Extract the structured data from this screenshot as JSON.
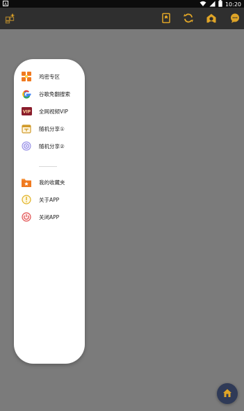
{
  "status_bar": {
    "left_icon": "android-notification-icon",
    "time": "10:20",
    "icons": [
      "wifi-icon",
      "cellular-signal-icon",
      "battery-icon"
    ]
  },
  "app_bar": {
    "icons": [
      "layout-grid-icon",
      "bookmark-icon",
      "refresh-icon",
      "home-profile-icon",
      "chat-icon"
    ],
    "accent_color": "#e0a527"
  },
  "drawer": {
    "items": [
      {
        "label": "鸡密专区",
        "icon": "section-grid-icon"
      },
      {
        "label": "谷歌免翻搜索",
        "icon": "google-icon"
      },
      {
        "label": "全网视频VIP",
        "icon": "vip-icon"
      },
      {
        "label": "随机分享①",
        "icon": "calendar-icon"
      },
      {
        "label": "随机分享②",
        "icon": "share-badge-icon"
      },
      {
        "label": "我的收藏夹",
        "icon": "favorites-folder-icon"
      },
      {
        "label": "关于APP",
        "icon": "info-icon"
      },
      {
        "label": "关闭APP",
        "icon": "power-icon"
      }
    ]
  },
  "fab": {
    "icon": "home-icon"
  }
}
